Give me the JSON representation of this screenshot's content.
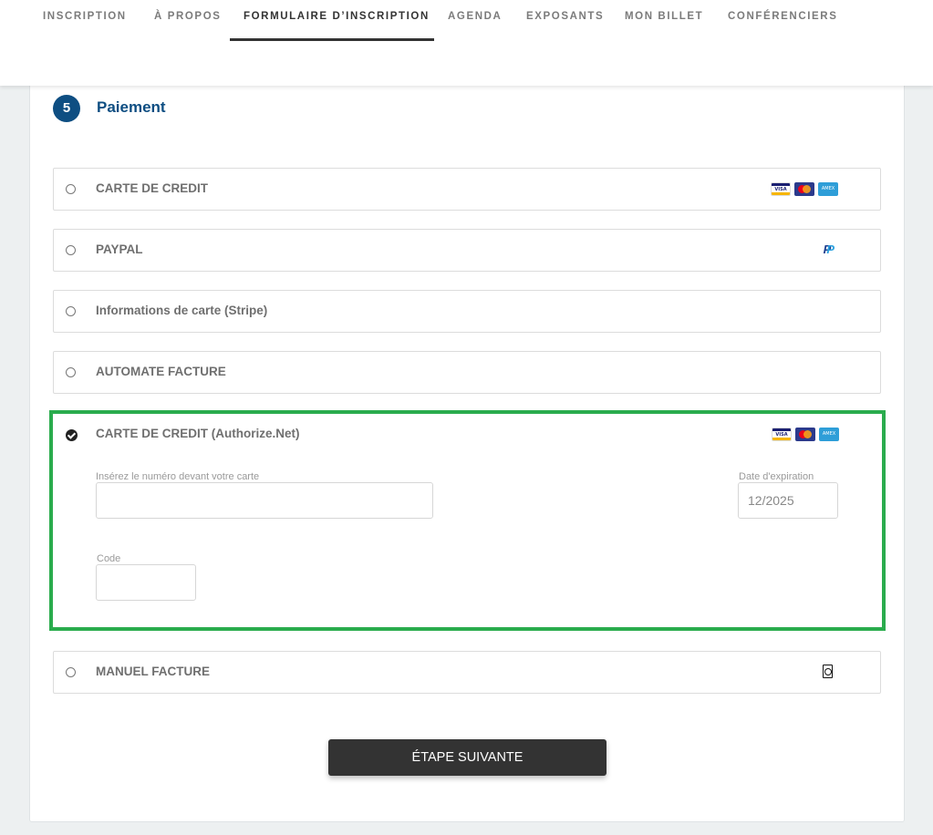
{
  "nav": {
    "tabs": [
      {
        "label": "INSCRIPTION"
      },
      {
        "label": "À PROPOS"
      },
      {
        "label": "FORMULAIRE D’INSCRIPTION"
      },
      {
        "label": "AGENDA"
      },
      {
        "label": "EXPOSANTS"
      },
      {
        "label": "MON BILLET"
      },
      {
        "label": "CONFÉRENCIERS"
      }
    ],
    "active_index": 2
  },
  "step": {
    "number": "5",
    "title": "Paiement"
  },
  "payment_options": [
    {
      "label": "CARTE DE CREDIT",
      "icon": "card-logos-icon",
      "selected": false
    },
    {
      "label": "PAYPAL",
      "icon": "paypal-icon",
      "selected": false
    },
    {
      "label": "Informations de carte (Stripe)",
      "icon": "",
      "selected": false
    },
    {
      "label": "AUTOMATE FACTURE",
      "icon": "",
      "selected": false
    },
    {
      "label": "CARTE DE CREDIT (Authorize.Net)",
      "icon": "card-logos-icon",
      "selected": true
    },
    {
      "label": "MANUEL FACTURE",
      "icon": "invoice-icon",
      "selected": false
    }
  ],
  "card_logos": {
    "visa": "VISA",
    "mastercard": "",
    "amex": "AMEX"
  },
  "paypal_mark": {
    "p1": "P",
    "p2": "P"
  },
  "authorize_form": {
    "card_number_label": "Insérez le numéro devant votre carte",
    "card_number_value": "",
    "expiry_label": "Date d'expiration",
    "expiry_value": "12/2025",
    "code_label": "Code",
    "code_value": ""
  },
  "next_button": {
    "label": "ÉTAPE SUIVANTE"
  },
  "colors": {
    "accent": "#0e4e82",
    "selected_border": "#2aac4d",
    "button": "#333333"
  }
}
